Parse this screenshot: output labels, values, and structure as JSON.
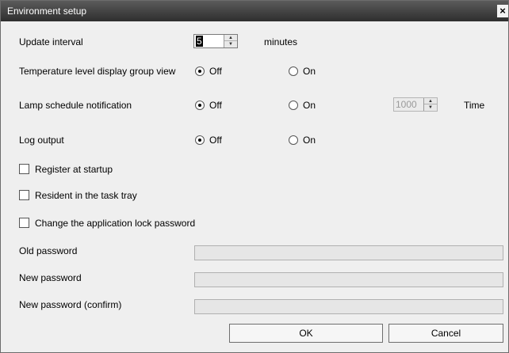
{
  "window": {
    "title": "Environment setup",
    "close_glyph": "×"
  },
  "update_interval": {
    "label": "Update interval",
    "value": "5",
    "unit": "minutes"
  },
  "temperature_display": {
    "label": "Temperature level display group view",
    "off": "Off",
    "on": "On",
    "selected": "Off"
  },
  "lamp_notification": {
    "label": "Lamp schedule notification",
    "off": "Off",
    "on": "On",
    "selected": "Off",
    "time_value": "1000",
    "time_label": "Time"
  },
  "log_output": {
    "label": "Log output",
    "off": "Off",
    "on": "On",
    "selected": "Off"
  },
  "checkboxes": {
    "register_startup": "Register at startup",
    "resident_tray": "Resident in the task tray",
    "change_lock_password": "Change the application lock password"
  },
  "passwords": {
    "old": "Old password",
    "new": "New password",
    "confirm": "New password (confirm)"
  },
  "buttons": {
    "ok": "OK",
    "cancel": "Cancel"
  }
}
